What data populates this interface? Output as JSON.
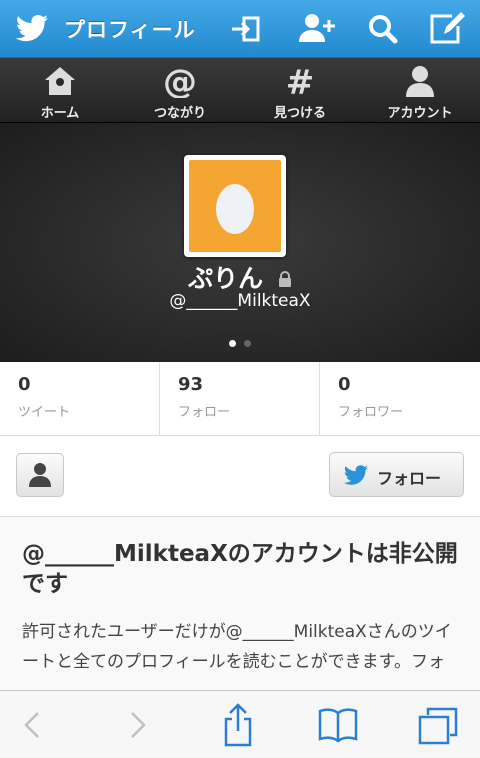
{
  "topbar": {
    "title": "プロフィール"
  },
  "nav": [
    {
      "label": "ホーム",
      "icon": "home-icon"
    },
    {
      "label": "つながり",
      "icon": "at-icon"
    },
    {
      "label": "見つける",
      "icon": "hash-icon"
    },
    {
      "label": "アカウント",
      "icon": "person-icon"
    }
  ],
  "profile": {
    "name": "ぷりん",
    "handle": "@______MilkteaX"
  },
  "stats": [
    {
      "count": "0",
      "label": "ツイート"
    },
    {
      "count": "93",
      "label": "フォロー"
    },
    {
      "count": "0",
      "label": "フォロワー"
    }
  ],
  "actions": {
    "follow_label": "フォロー"
  },
  "protected": {
    "title": "@______MilkteaXのアカウントは非公開です",
    "body": "許可されたユーザーだけが@______MilkteaXさんのツイートと全てのプロフィールを読むことができます。フォ"
  },
  "colors": {
    "accent": "#2a92d8",
    "avatar_bg": "#f4a532",
    "header_bg": "#2a2a2a"
  }
}
